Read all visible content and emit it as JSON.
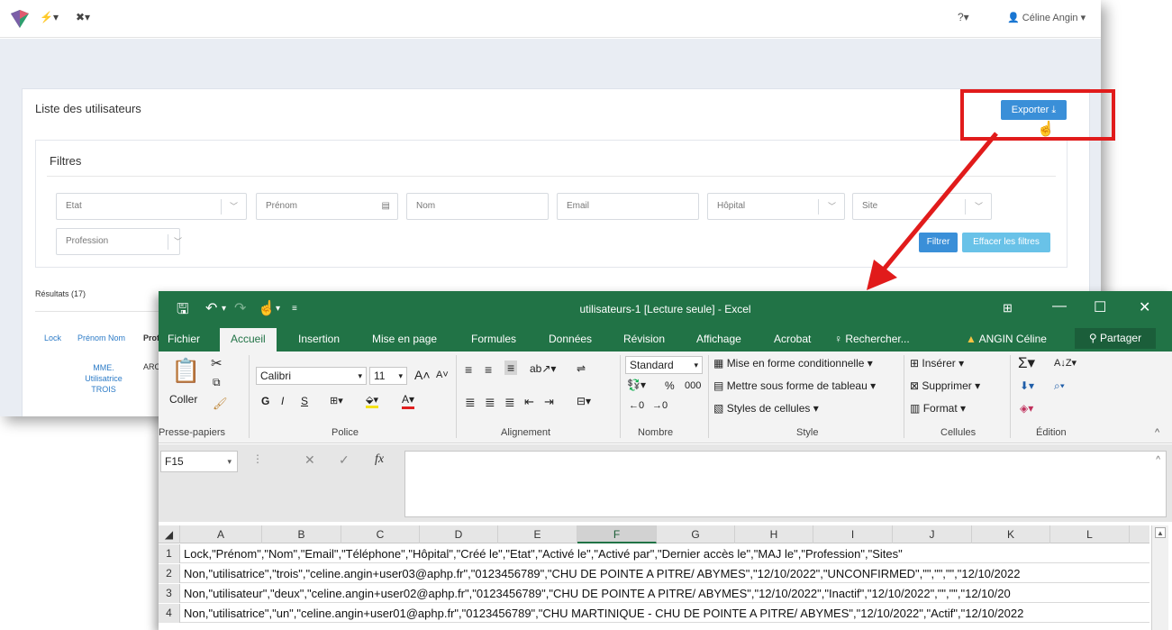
{
  "web": {
    "nav": {
      "bolt": "⚡▾",
      "tools": "✖▾",
      "help": "?▾",
      "user": "Céline Angin"
    },
    "panel_title": "Liste des utilisateurs",
    "export_label": "Exporter",
    "filters_title": "Filtres",
    "filters": {
      "etat": "Etat",
      "prenom": "Prénom",
      "nom": "Nom",
      "email": "Email",
      "hopital": "Hôpital",
      "site": "Site",
      "profession": "Profession"
    },
    "filtrer_label": "Filtrer",
    "effacer_label": "Effacer les filtres",
    "results": "Résultats (17)",
    "table": {
      "headers": [
        "Lock",
        "Prénom Nom",
        "Prof"
      ],
      "row_name": [
        "MME.",
        "Utilisatrice",
        "TROIS"
      ],
      "row_prof": "ARC"
    }
  },
  "excel": {
    "title": "utilisateurs-1  [Lecture seule] - Excel",
    "tabs": [
      "Fichier",
      "Accueil",
      "Insertion",
      "Mise en page",
      "Formules",
      "Données",
      "Révision",
      "Affichage",
      "Acrobat"
    ],
    "search": "Rechercher...",
    "user": "ANGIN Céline",
    "share": "Partager",
    "ribbon": {
      "coller": "Coller",
      "font_name": "Calibri",
      "font_size": "11",
      "bold": "G",
      "italic": "I",
      "underline": "S",
      "number_format": "Standard",
      "percent": "%",
      "thousands": "000",
      "cond_format": "Mise en forme conditionnelle",
      "table_format": "Mettre sous forme de tableau",
      "cell_styles": "Styles de cellules",
      "insert": "Insérer",
      "delete": "Supprimer",
      "format": "Format",
      "groups": [
        "Presse-papiers",
        "Police",
        "Alignement",
        "Nombre",
        "Style",
        "Cellules",
        "Édition"
      ]
    },
    "name_box": "F15",
    "fx": "fx",
    "columns": [
      "A",
      "B",
      "C",
      "D",
      "E",
      "F",
      "G",
      "H",
      "I",
      "J",
      "K",
      "L"
    ],
    "rows": [
      {
        "n": "1",
        "text": "Lock,\"Prénom\",\"Nom\",\"Email\",\"Téléphone\",\"Hôpital\",\"Créé le\",\"Etat\",\"Activé le\",\"Activé par\",\"Dernier accès le\",\"MAJ le\",\"Profession\",\"Sites\""
      },
      {
        "n": "2",
        "text": "Non,\"utilisatrice\",\"trois\",\"celine.angin+user03@aphp.fr\",\"0123456789\",\"CHU DE POINTE A PITRE/ ABYMES\",\"12/10/2022\",\"UNCONFIRMED\",\"\",\"\",\"\",\"12/10/2022"
      },
      {
        "n": "3",
        "text": "Non,\"utilisateur\",\"deux\",\"celine.angin+user02@aphp.fr\",\"0123456789\",\"CHU DE POINTE A PITRE/ ABYMES\",\"12/10/2022\",\"Inactif\",\"12/10/2022\",\"\",\"\",\"12/10/20"
      },
      {
        "n": "4",
        "text": "Non,\"utilisatrice\",\"un\",\"celine.angin+user01@aphp.fr\",\"0123456789\",\"CHU MARTINIQUE - CHU DE POINTE A PITRE/ ABYMES\",\"12/10/2022\",\"Actif\",\"12/10/2022"
      }
    ]
  },
  "colors": {
    "excel_green": "#217346",
    "annotation_red": "#e11b1b",
    "button_blue": "#3a8fd8"
  }
}
